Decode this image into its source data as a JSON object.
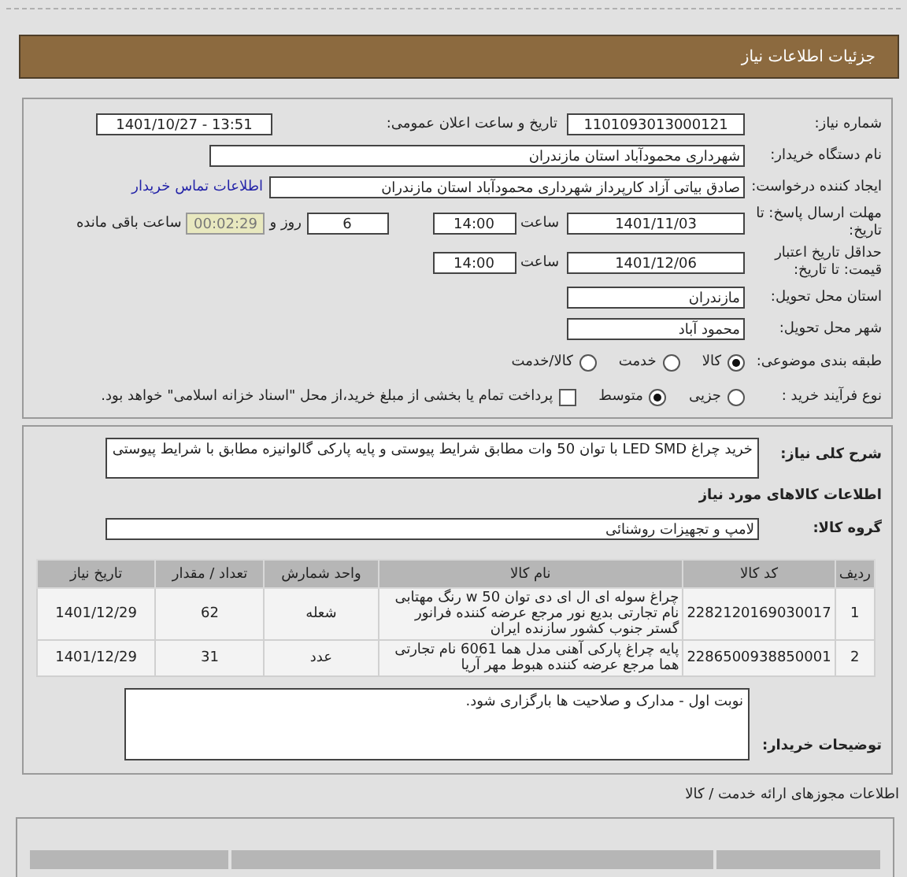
{
  "header": {
    "title": "جزئیات اطلاعات نیاز"
  },
  "details": {
    "need_number": {
      "label": "شماره نیاز:",
      "value": "1101093013000121"
    },
    "announce": {
      "label": "تاریخ و ساعت اعلان عمومی:",
      "value": "1401/10/27 - 13:51"
    },
    "buyer": {
      "label": "نام دستگاه خریدار:",
      "value": "شهرداری محمودآباد استان مازندران"
    },
    "creator": {
      "label": "ایجاد کننده درخواست:",
      "value": "صادق بیاتی آزاد کارپرداز شهرداری محمودآباد استان مازندران",
      "link": "اطلاعات تماس خریدار"
    },
    "deadline": {
      "label": "مهلت ارسال پاسخ: تا تاریخ:",
      "date": "1401/11/03",
      "time_label": "ساعت",
      "time": "14:00",
      "days": "6",
      "days_label": "روز و",
      "remaining": "00:02:29",
      "remaining_label": "ساعت باقی مانده"
    },
    "validity": {
      "label": "حداقل تاریخ اعتبار قیمت: تا تاریخ:",
      "date": "1401/12/06",
      "time_label": "ساعت",
      "time": "14:00"
    },
    "province": {
      "label": "استان محل تحویل:",
      "value": "مازندران"
    },
    "city": {
      "label": "شهر محل تحویل:",
      "value": "محمود آباد"
    },
    "category": {
      "label": "طبقه بندی موضوعی:",
      "options": [
        {
          "label": "کالا",
          "selected": true
        },
        {
          "label": "خدمت",
          "selected": false
        },
        {
          "label": "کالا/خدمت",
          "selected": false
        }
      ]
    },
    "process": {
      "label": "نوع فرآیند خرید :",
      "options": [
        {
          "label": "جزیی",
          "selected": false
        },
        {
          "label": "متوسط",
          "selected": true
        }
      ],
      "payment": {
        "checked": false,
        "label": "پرداخت تمام یا بخشی از مبلغ خرید،از محل \"اسناد خزانه اسلامی\" خواهد بود."
      }
    }
  },
  "needs": {
    "description": {
      "label": "شرح کلی نیاز:",
      "value": "خرید چراغ LED SMD با توان 50 وات مطابق شرایط پیوستی و پایه پارکی گالوانیزه مطابق با شرایط پیوستی"
    },
    "goods_heading": "اطلاعات کالاهای مورد نیاز",
    "group": {
      "label": "گروه کالا:",
      "value": "لامپ و تجهیزات روشنائی"
    },
    "table": {
      "columns": [
        "ردیف",
        "کد کالا",
        "نام کالا",
        "واحد شمارش",
        "تعداد / مقدار",
        "تاریخ نیاز"
      ],
      "rows": [
        [
          "1",
          "2282120169030017",
          "چراغ سوله ای ال ای دی توان 50 w رنگ مهتابی نام تجارتی بدیع نور مرجع عرضه کننده فرانور گستر جنوب کشور سازنده ایران",
          "شعله",
          "62",
          "1401/12/29"
        ],
        [
          "2",
          "2286500938850001",
          "پایه چراغ پارکی آهنی مدل هما 6061 نام تجارتی هما مرجع عرضه کننده هبوط مهر آریا",
          "عدد",
          "31",
          "1401/12/29"
        ]
      ]
    },
    "notes": {
      "label": "توضیحات خریدار:",
      "value": "نوبت اول - مدارک و صلاحیت ها بارگزاری شود."
    }
  },
  "licenses": {
    "title": "اطلاعات مجوزهای ارائه خدمت / کالا"
  }
}
